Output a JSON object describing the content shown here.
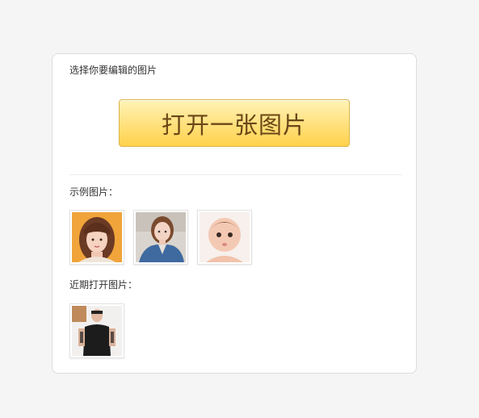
{
  "panel": {
    "select_title": "选择你要编辑的图片",
    "open_button_label": "打开一张图片",
    "examples_label": "示例图片：",
    "recent_label": "近期打开图片："
  },
  "examples": [
    {
      "name": "example-photo-1",
      "subject": "woman with bangs on orange background"
    },
    {
      "name": "example-photo-2",
      "subject": "woman in denim jacket"
    },
    {
      "name": "example-photo-3",
      "subject": "baby"
    }
  ],
  "recent": [
    {
      "name": "recent-photo-1",
      "subject": "man in black t-shirt"
    }
  ],
  "colors": {
    "button_gradient_top": "#fff3b8",
    "button_gradient_bottom": "#ffd24d",
    "button_text": "#6b4717",
    "page_bg": "#f5f5f5"
  }
}
